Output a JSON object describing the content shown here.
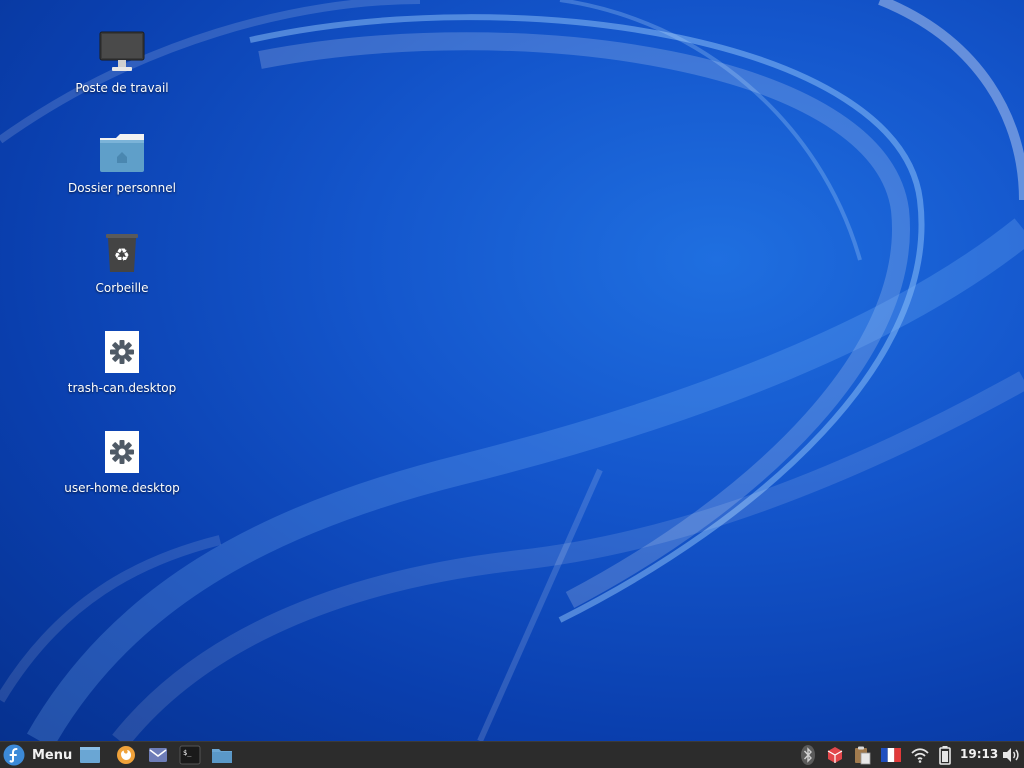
{
  "desktop": {
    "icons": [
      {
        "label": "Poste de travail",
        "icon": "computer-icon"
      },
      {
        "label": "Dossier personnel",
        "icon": "home-folder-icon"
      },
      {
        "label": "Corbeille",
        "icon": "trash-icon"
      },
      {
        "label": "trash-can.desktop",
        "icon": "settings-file-icon"
      },
      {
        "label": "user-home.desktop",
        "icon": "settings-file-icon"
      }
    ]
  },
  "taskbar": {
    "menu_label": "Menu",
    "launchers": [
      "show-desktop-icon",
      "firefox-icon",
      "mail-icon",
      "terminal-icon",
      "file-manager-icon"
    ],
    "tray": [
      "bluetooth-icon",
      "package-updates-icon",
      "clipboard-icon",
      "keyboard-layout-fr-icon",
      "wifi-icon",
      "battery-icon"
    ],
    "clock": "19:13",
    "volume_icon": "volume-icon"
  },
  "colors": {
    "wallpaper_base": "#1456cc",
    "taskbar_bg": "#2c2c2c",
    "accent": "#3c8ad8"
  }
}
